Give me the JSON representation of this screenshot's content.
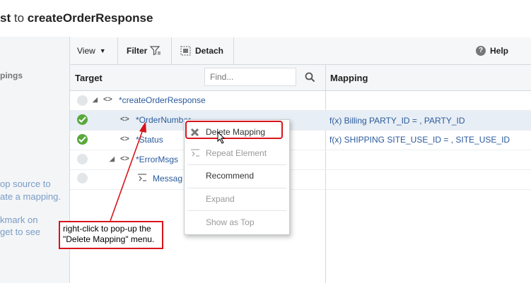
{
  "title": {
    "prefix": "st",
    "connector": "to",
    "target": "createOrderResponse"
  },
  "left_panel": {
    "heading": "pings",
    "hint1": [
      "op source to",
      "ate a mapping."
    ],
    "hint2": [
      "kmark on",
      "get to see"
    ]
  },
  "toolbar": {
    "view": "View",
    "filter": "Filter",
    "detach": "Detach",
    "help": "Help"
  },
  "columns": {
    "target": "Target",
    "mapping": "Mapping",
    "find_placeholder": "Find..."
  },
  "tree": [
    {
      "label": "*createOrderResponse",
      "mapped": false
    },
    {
      "label": "*OrderNumber",
      "mapped": true,
      "mapping": "f(x) Billing PARTY_ID = , PARTY_ID"
    },
    {
      "label": "*Status",
      "mapped": true,
      "mapping": "f(x) SHIPPING SITE_USE_ID = , SITE_USE_ID"
    },
    {
      "label": "*ErrorMsgs",
      "mapped": false
    },
    {
      "label": "Messag",
      "mapped": false
    }
  ],
  "context_menu": {
    "delete_mapping": "Delete Mapping",
    "repeat_element": "Repeat Element",
    "recommend": "Recommend",
    "expand": "Expand",
    "show_as_top": "Show as Top"
  },
  "callout": {
    "line1": "right-click to pop-up the",
    "line2": "\"Delete Mapping\" menu."
  },
  "colors": {
    "accent_red": "#d8141a",
    "link_blue": "#2a5a9c",
    "ok_green": "#59a83c"
  }
}
